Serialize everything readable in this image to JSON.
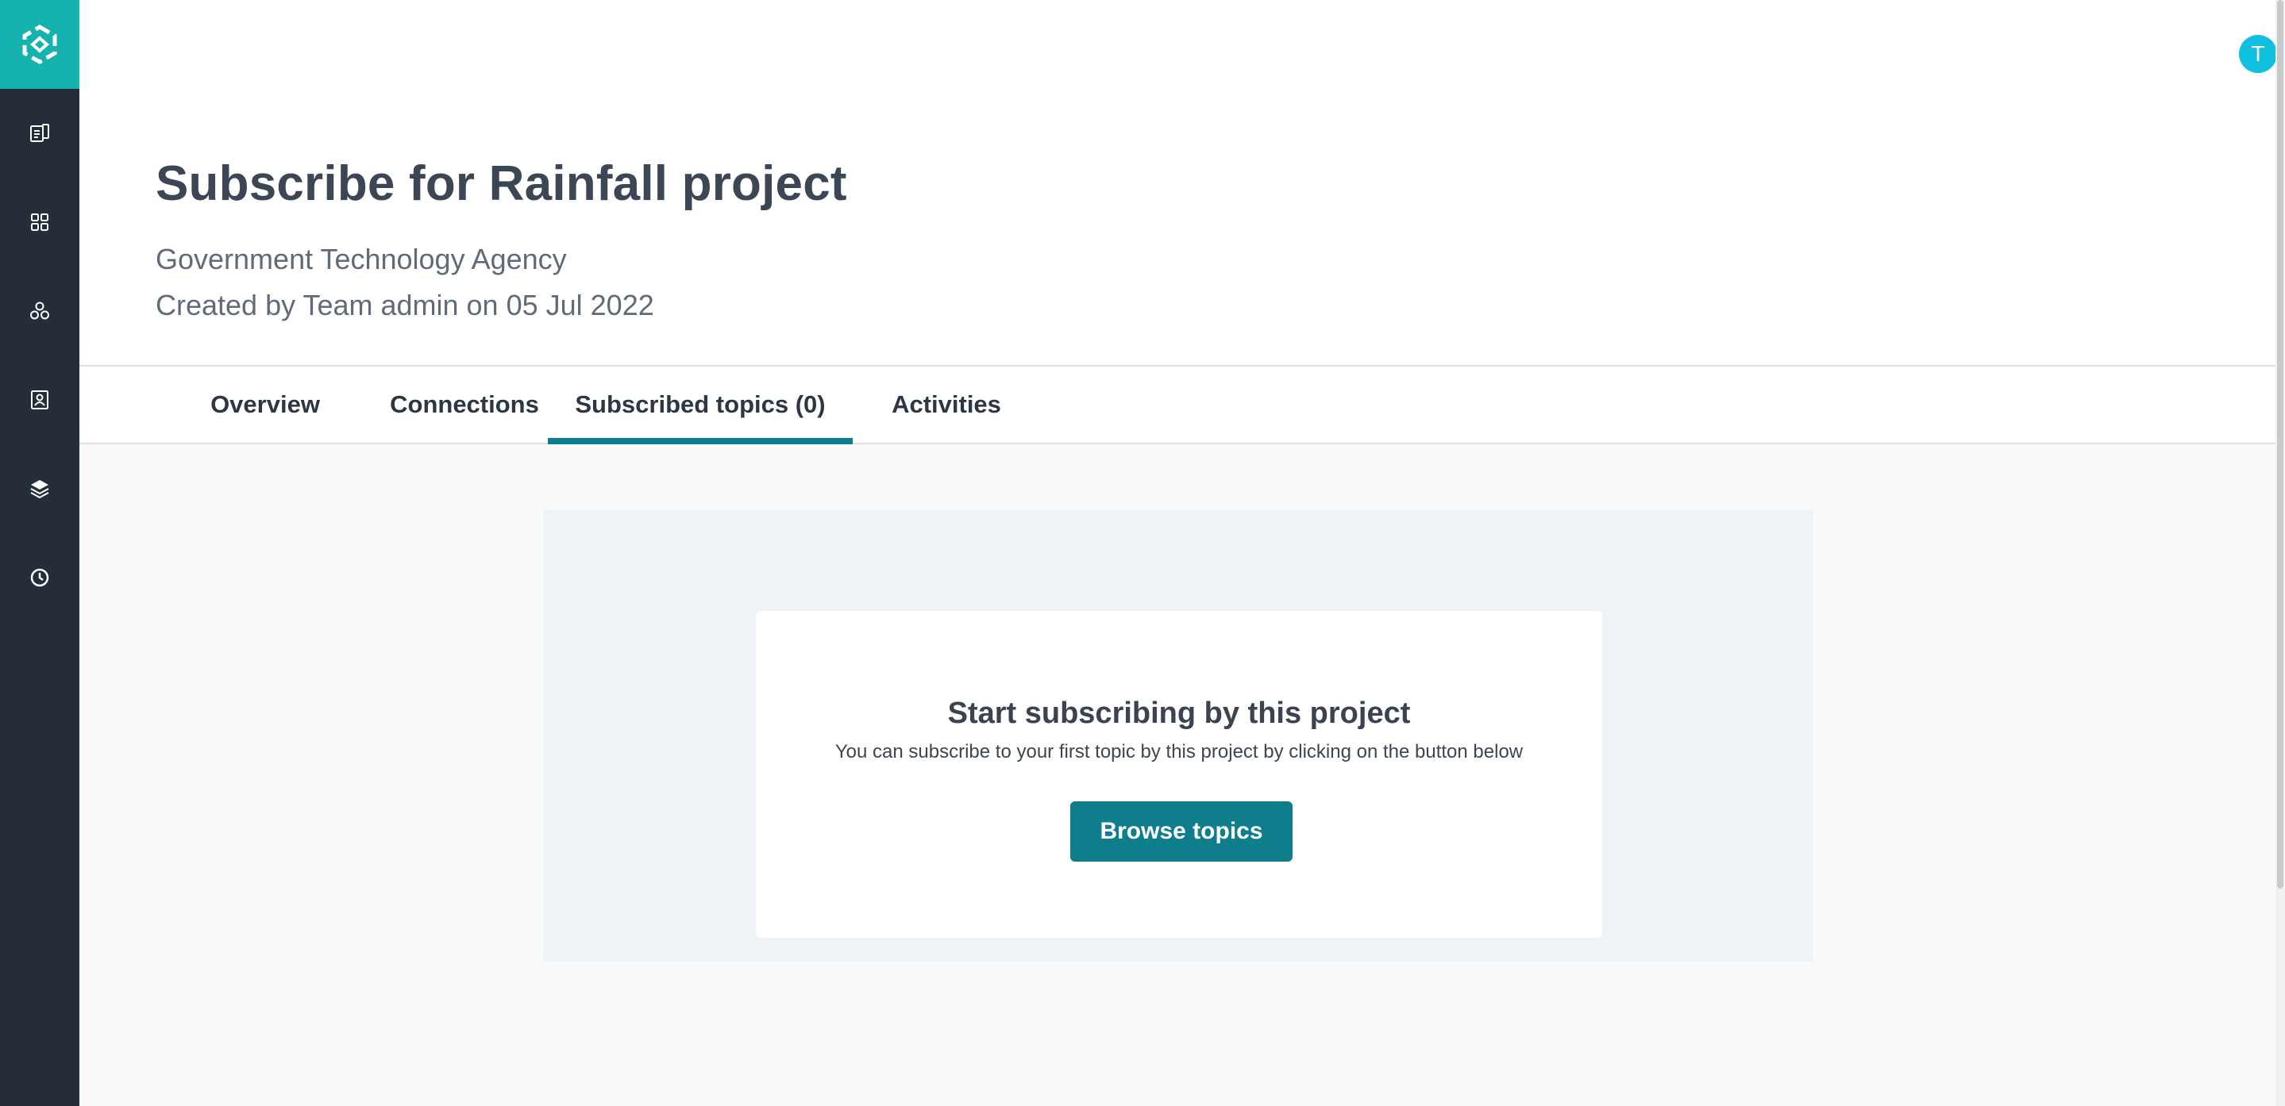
{
  "sidebar": {
    "logo_icon": "hexagon-logo-icon",
    "items": [
      {
        "icon": "documents-icon"
      },
      {
        "icon": "grid-icon"
      },
      {
        "icon": "network-icon"
      },
      {
        "icon": "contact-card-icon"
      },
      {
        "icon": "layers-icon"
      },
      {
        "icon": "clock-icon"
      }
    ],
    "colors": {
      "background": "#252d39",
      "logo_background": "#16b3ae"
    }
  },
  "header": {
    "avatar_initial": "T",
    "avatar_color": "#11bfe0",
    "title": "Subscribe for Rainfall project",
    "organization": "Government Technology Agency",
    "created": "Created by Team admin on 05 Jul 2022"
  },
  "tabs": [
    {
      "label": "Overview",
      "active": false
    },
    {
      "label": "Connections",
      "active": false
    },
    {
      "label": "Subscribed topics (0)",
      "active": true
    },
    {
      "label": "Activities",
      "active": false
    }
  ],
  "empty_state": {
    "title": "Start subscribing by this project",
    "description": "You can subscribe to your first topic by this project by clicking on the button below",
    "button_label": "Browse topics",
    "accent_color": "#0f7e8c"
  }
}
